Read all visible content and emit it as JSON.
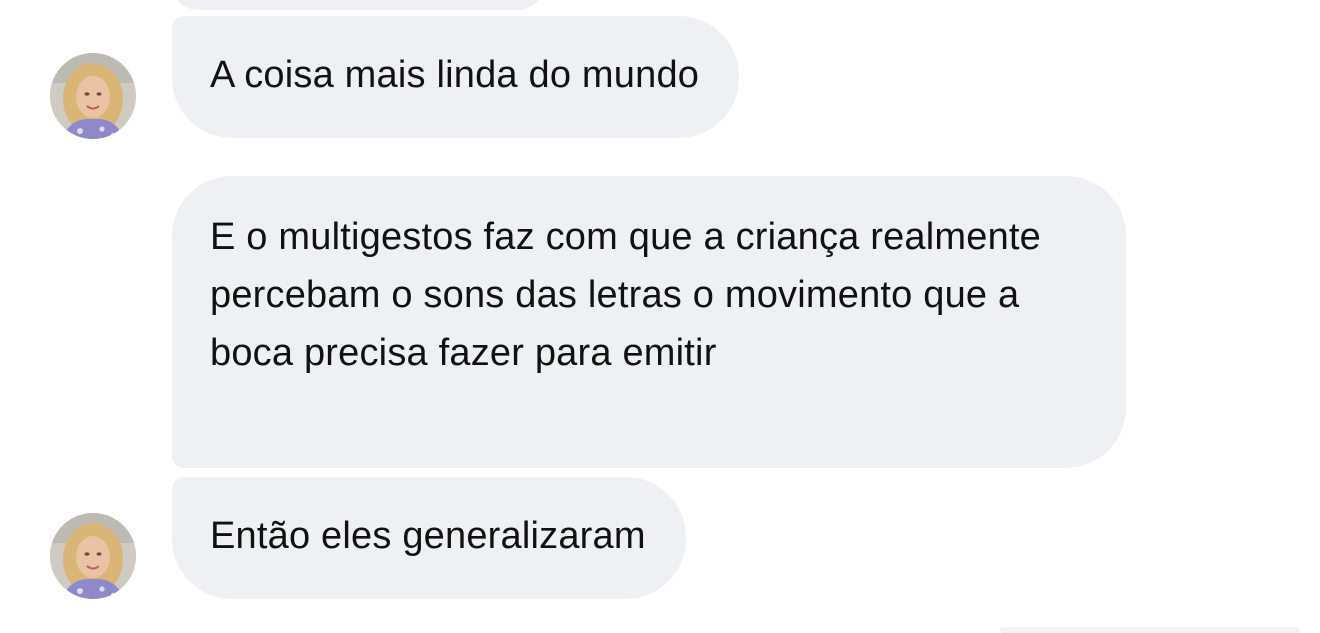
{
  "conversation": {
    "messages": [
      {
        "id": "msg-1",
        "text": "A coisa mais linda do mundo",
        "has_avatar": true
      },
      {
        "id": "msg-2",
        "text": "E o multigestos faz com que a criança realmente percebam o sons das letras o movimento que a boca precisa fazer para emitir",
        "has_avatar": false
      },
      {
        "id": "msg-3",
        "text": "Então eles generalizaram",
        "has_avatar": true
      }
    ]
  },
  "colors": {
    "bubble_background": "#eff0f3",
    "text": "#111111",
    "page_background": "#ffffff"
  },
  "icons": {
    "avatar": "profile-photo-avatar-icon"
  }
}
